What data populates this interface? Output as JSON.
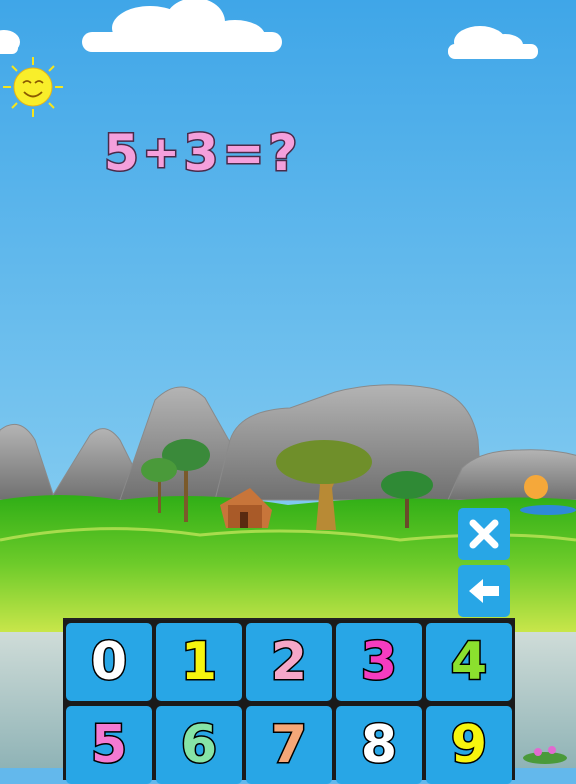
{
  "equation": {
    "a": "5",
    "op": "+",
    "b": "3",
    "eq": "=",
    "answer": "?"
  },
  "colors": {
    "sky": "#63b8ec",
    "equation_text": "#f5a0dc",
    "key_bg": "#28a6e6",
    "mountain": "#9a9a9a",
    "grass": "#3bb520",
    "water": "#a7c5c7"
  },
  "controls": {
    "clear_icon": "close-icon",
    "back_icon": "arrow-left-icon"
  },
  "keypad": {
    "keys": [
      {
        "label": "0",
        "color": "#ffffff"
      },
      {
        "label": "1",
        "color": "#f7f50e"
      },
      {
        "label": "2",
        "color": "#f5a7c8"
      },
      {
        "label": "3",
        "color": "#f53cc0"
      },
      {
        "label": "4",
        "color": "#8be02e"
      },
      {
        "label": "5",
        "color": "#f47ad2"
      },
      {
        "label": "6",
        "color": "#86e4a6"
      },
      {
        "label": "7",
        "color": "#f5a778"
      },
      {
        "label": "8",
        "color": "#ffffff"
      },
      {
        "label": "9",
        "color": "#f7f50e"
      }
    ]
  }
}
